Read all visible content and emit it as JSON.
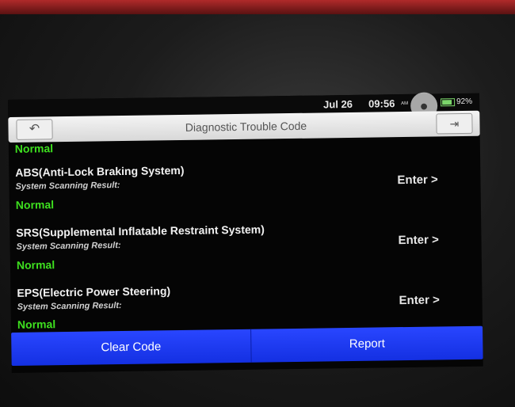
{
  "status_bar": {
    "date": "Jul 26",
    "time": "09:56",
    "ampm": "AM",
    "battery": "92%"
  },
  "header": {
    "title": "Diagnostic Trouble Code",
    "back_icon": "back-arrow-icon",
    "exit_icon": "exit-icon"
  },
  "partial_top_status": "Normal",
  "systems": [
    {
      "name": "ABS(Anti-Lock Braking System)",
      "subtitle": "System Scanning Result:",
      "status": "Normal",
      "action": "Enter >"
    },
    {
      "name": "SRS(Supplemental Inflatable Restraint System)",
      "subtitle": "System Scanning Result:",
      "status": "Normal",
      "action": "Enter >"
    },
    {
      "name": "EPS(Electric Power Steering)",
      "subtitle": "System Scanning Result:",
      "status": "Normal",
      "action": "Enter >"
    }
  ],
  "actions": {
    "clear_code": "Clear Code",
    "report": "Report"
  },
  "colors": {
    "normal_status": "#3ee01f",
    "action_bar": "#1f3cf0",
    "device_housing": "#b02a2a"
  }
}
